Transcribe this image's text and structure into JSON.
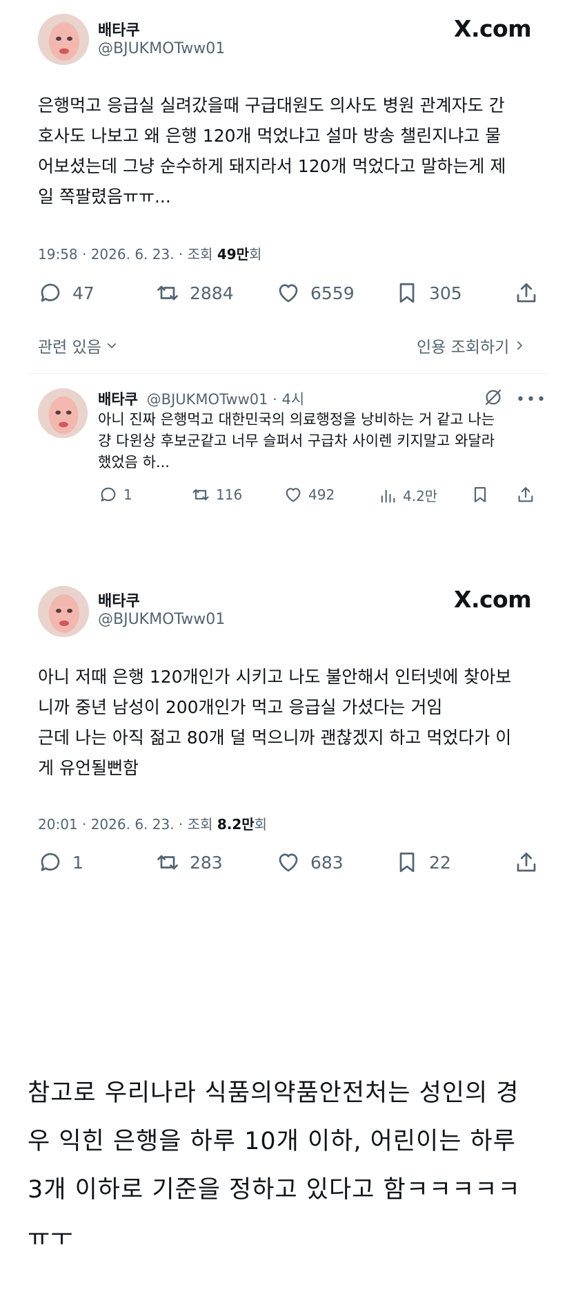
{
  "tweet1": {
    "name": "배타쿠",
    "handle": "@BJUKMOTww01",
    "brand": "X.com",
    "text": "은행먹고 응급실 실려갔을때 구급대원도 의사도 병원 관계자도 간\n호사도 나보고 왜 은행 120개 먹었냐고 설마 방송 챌린지냐고 물\n어보셨는데 그냥 순수하게 돼지라서 120개 먹었다고 말하는게 제\n일 쪽팔렸음ㅠㅠ...",
    "time": "19:58 · 2026. 6. 23. · 조회 ",
    "views": "49만",
    "views_suffix": "회",
    "replies": "47",
    "reposts": "2884",
    "likes": "6559",
    "bookmarks": "305",
    "related_label": "관련 있음",
    "quotes_label": "인용 조회하기"
  },
  "reply": {
    "name": "배타쿠",
    "handle_time": "@BJUKMOTww01 · 4시",
    "text": "아니 진짜 은행먹고 대한민국의 의료행정을 낭비하는 거 같고 나는\n걍 다윈상 후보군같고 너무 슬퍼서 구급차 사이렌 키지말고 와달라\n했었음 하...",
    "replies": "1",
    "reposts": "116",
    "likes": "492",
    "views": "4.2만"
  },
  "tweet2": {
    "name": "배타쿠",
    "handle": "@BJUKMOTww01",
    "brand": "X.com",
    "text": "아니 저때 은행 120개인가 시키고 나도 불안해서 인터넷에 찾아보\n니까 중년 남성이 200개인가 먹고 응급실 가셨다는 거임\n근데 나는 아직 젊고 80개 덜 먹으니까 괜찮겠지 하고 먹었다가 이\n게 유언될뻔함",
    "time": "20:01 · 2026. 6. 23. · 조회 ",
    "views": "8.2만",
    "views_suffix": "회",
    "replies": "1",
    "reposts": "283",
    "likes": "683",
    "bookmarks": "22"
  },
  "note": {
    "text": "참고로 우리나라 식품의약품안전처는 성인의 경\n우 익힌 은행을 하루 10개 이하, 어린이는 하루\n3개 이하로 기준을 정하고 있다고 함ㅋㅋㅋㅋㅋ\nㅠㅜ"
  }
}
